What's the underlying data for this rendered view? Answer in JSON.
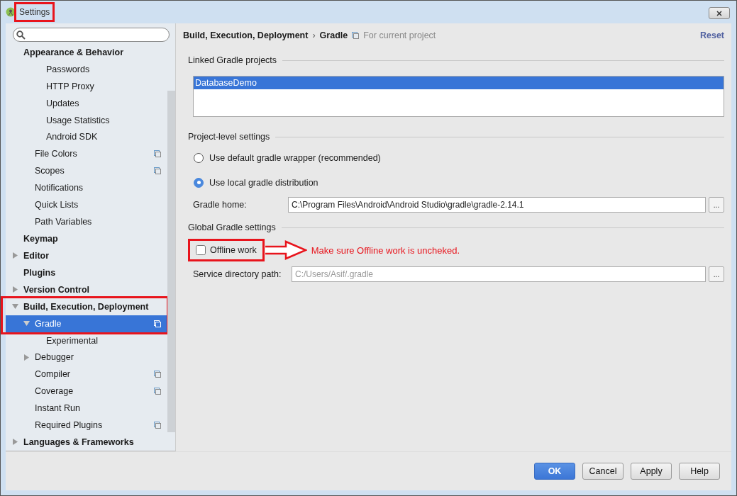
{
  "window": {
    "title": "Settings"
  },
  "tree": [
    {
      "label": "Appearance & Behavior",
      "selected": false,
      "per_project": false,
      "children": [
        {
          "children": [
            {
              "label": "Passwords",
              "selected": false,
              "per_project": false
            },
            {
              "label": "HTTP Proxy",
              "selected": false,
              "per_project": false
            },
            {
              "label": "Updates",
              "selected": false,
              "per_project": false
            },
            {
              "label": "Usage Statistics",
              "selected": false,
              "per_project": false
            },
            {
              "label": "Android SDK",
              "selected": false,
              "per_project": false
            }
          ]
        },
        {
          "label": "File Colors",
          "selected": false,
          "per_project": true
        },
        {
          "label": "Scopes",
          "selected": false,
          "per_project": true
        },
        {
          "label": "Notifications",
          "selected": false,
          "per_project": false
        },
        {
          "label": "Quick Lists",
          "selected": false,
          "per_project": false
        },
        {
          "label": "Path Variables",
          "selected": false,
          "per_project": false
        }
      ]
    },
    {
      "label": "Keymap",
      "selected": false,
      "per_project": false
    },
    {
      "label": "Editor",
      "selected": false,
      "per_project": false,
      "expanded": false
    },
    {
      "label": "Plugins",
      "selected": false,
      "per_project": false
    },
    {
      "label": "Version Control",
      "selected": false,
      "per_project": false,
      "expanded": false
    },
    {
      "label": "Build, Execution, Deployment",
      "selected": false,
      "per_project": false,
      "expanded": true,
      "highlighted": true,
      "children": [
        {
          "label": "Gradle",
          "selected": true,
          "per_project": true,
          "expanded": true,
          "highlighted": true,
          "children": [
            {
              "label": "Experimental",
              "selected": false,
              "per_project": false
            }
          ]
        },
        {
          "label": "Debugger",
          "selected": false,
          "per_project": false,
          "expanded": false
        },
        {
          "label": "Compiler",
          "selected": false,
          "per_project": true
        },
        {
          "label": "Coverage",
          "selected": false,
          "per_project": true
        },
        {
          "label": "Instant Run",
          "selected": false,
          "per_project": false
        },
        {
          "label": "Required Plugins",
          "selected": false,
          "per_project": true
        }
      ]
    },
    {
      "label": "Languages & Frameworks",
      "selected": false,
      "per_project": false,
      "expanded": false
    }
  ],
  "breadcrumb": {
    "parent": "Build, Execution, Deployment",
    "separator": "›",
    "current": "Gradle",
    "scope": "For current project"
  },
  "reset_link": "Reset",
  "linked_projects": {
    "title": "Linked Gradle projects",
    "items": [
      {
        "label": "DatabaseDemo",
        "selected": true
      }
    ]
  },
  "project_level": {
    "title": "Project-level settings",
    "options": [
      {
        "label": "Use default gradle wrapper (recommended)",
        "selected": false
      },
      {
        "label": "Use local gradle distribution",
        "selected": true
      }
    ],
    "gradle_home": {
      "label": "Gradle home:",
      "value": "C:\\Program Files\\Android\\Android Studio\\gradle\\gradle-2.14.1",
      "browse": "..."
    }
  },
  "global": {
    "title": "Global Gradle settings",
    "offline_work": {
      "label": "Offline work",
      "checked": false
    },
    "annotation": "Make sure Offline work is uncheked.",
    "service_dir": {
      "label": "Service directory path:",
      "placeholder": "C:/Users/Asif/.gradle",
      "browse": "..."
    }
  },
  "buttons": [
    {
      "label": "OK",
      "kind": "primary"
    },
    {
      "label": "Cancel",
      "kind": "normal"
    },
    {
      "label": "Apply",
      "kind": "normal"
    },
    {
      "label": "Help",
      "kind": "normal"
    }
  ]
}
